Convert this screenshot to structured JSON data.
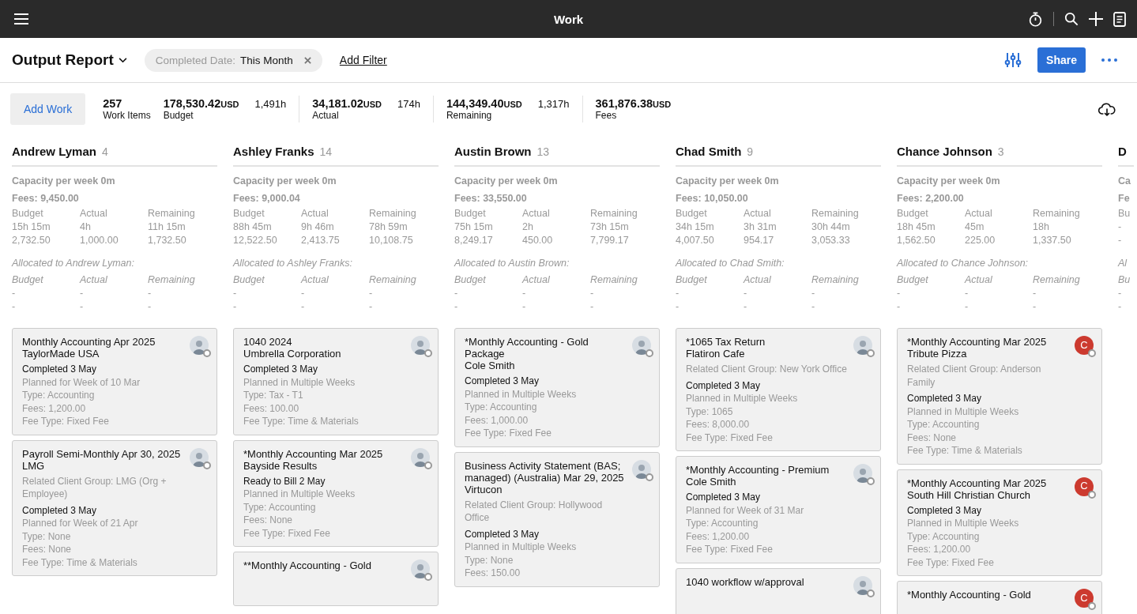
{
  "app_bar": {
    "title": "Work"
  },
  "toolbar": {
    "report_title": "Output Report",
    "filter": {
      "label": "Completed Date:",
      "value": "This Month"
    },
    "add_filter": "Add Filter",
    "share": "Share"
  },
  "summary": {
    "add_button": "Add Work",
    "stats": [
      {
        "value": "257",
        "label": "Work Items"
      },
      {
        "value": "178,530.42",
        "unit": "USD",
        "hours": "1,491h",
        "label": "Budget"
      },
      {
        "value": "34,181.02",
        "unit": "USD",
        "hours": "174h",
        "label": "Actual"
      },
      {
        "value": "144,349.40",
        "unit": "USD",
        "hours": "1,317h",
        "label": "Remaining"
      },
      {
        "value": "361,876.38",
        "unit": "USD",
        "label": "Fees"
      }
    ]
  },
  "columns": [
    {
      "name": "Andrew Lyman",
      "count": "4",
      "capacity": "Capacity per week 0m",
      "fees": "Fees: 9,450.00",
      "totals": {
        "headers": [
          "Budget",
          "Actual",
          "Remaining"
        ],
        "hours": [
          "15h 15m",
          "4h",
          "11h 15m"
        ],
        "amounts": [
          "2,732.50",
          "1,000.00",
          "1,732.50"
        ]
      },
      "allocated_label": "Allocated to Andrew Lyman:",
      "allocated": {
        "headers": [
          "Budget",
          "Actual",
          "Remaining"
        ],
        "hours": [
          "-",
          "-",
          "-"
        ],
        "amounts": [
          "-",
          "-",
          "-"
        ]
      },
      "cards": [
        {
          "title": "Monthly Accounting Apr 2025",
          "client": "TaylorMade USA",
          "status": "Completed 3 May",
          "details": [
            "Planned for Week of 10 Mar",
            "Type: Accounting",
            "Fees: 1,200.00",
            "Fee Type: Fixed Fee"
          ],
          "avatar": {
            "kind": "photo"
          }
        },
        {
          "title": "Payroll Semi-Monthly Apr 30, 2025",
          "client": "LMG",
          "related": "Related Client Group: LMG (Org + Employee)",
          "status": "Completed 3 May",
          "details": [
            "Planned for Week of 21 Apr",
            "Type: None",
            "Fees: None",
            "Fee Type: Time & Materials"
          ],
          "avatar": {
            "kind": "photo"
          }
        }
      ]
    },
    {
      "name": "Ashley Franks",
      "count": "14",
      "capacity": "Capacity per week 0m",
      "fees": "Fees: 9,000.04",
      "totals": {
        "headers": [
          "Budget",
          "Actual",
          "Remaining"
        ],
        "hours": [
          "88h 45m",
          "9h 46m",
          "78h 59m"
        ],
        "amounts": [
          "12,522.50",
          "2,413.75",
          "10,108.75"
        ]
      },
      "allocated_label": "Allocated to Ashley Franks:",
      "allocated": {
        "headers": [
          "Budget",
          "Actual",
          "Remaining"
        ],
        "hours": [
          "-",
          "-",
          "-"
        ],
        "amounts": [
          "-",
          "-",
          "-"
        ]
      },
      "cards": [
        {
          "title": "1040 2024",
          "client": "Umbrella Corporation",
          "status": "Completed 3 May",
          "details": [
            "Planned in Multiple Weeks",
            "Type: Tax - T1",
            "Fees: 100.00",
            "Fee Type: Time & Materials"
          ],
          "avatar": {
            "kind": "photo"
          }
        },
        {
          "title": "*Monthly Accounting Mar 2025",
          "client": "Bayside Results",
          "status": "Ready to Bill 2 May",
          "details": [
            "Planned in Multiple Weeks",
            "Type: Accounting",
            "Fees: None",
            "Fee Type: Fixed Fee"
          ],
          "avatar": {
            "kind": "photo"
          }
        },
        {
          "title": "**Monthly Accounting - Gold",
          "avatar": {
            "kind": "photo"
          }
        }
      ]
    },
    {
      "name": "Austin Brown",
      "count": "13",
      "capacity": "Capacity per week 0m",
      "fees": "Fees: 33,550.00",
      "totals": {
        "headers": [
          "Budget",
          "Actual",
          "Remaining"
        ],
        "hours": [
          "75h 15m",
          "2h",
          "73h 15m"
        ],
        "amounts": [
          "8,249.17",
          "450.00",
          "7,799.17"
        ]
      },
      "allocated_label": "Allocated to Austin Brown:",
      "allocated": {
        "headers": [
          "Budget",
          "Actual",
          "Remaining"
        ],
        "hours": [
          "-",
          "-",
          "-"
        ],
        "amounts": [
          "-",
          "-",
          "-"
        ]
      },
      "cards": [
        {
          "title": "*Monthly Accounting - Gold Package",
          "client": "Cole Smith",
          "status": "Completed 3 May",
          "details": [
            "Planned in Multiple Weeks",
            "Type: Accounting",
            "Fees: 1,000.00",
            "Fee Type: Fixed Fee"
          ],
          "avatar": {
            "kind": "photo"
          }
        },
        {
          "title": "Business Activity Statement (BAS; managed) (Australia) Mar 29, 2025",
          "client": "Virtucon",
          "related": "Related Client Group: Hollywood Office",
          "status": "Completed 3 May",
          "details": [
            "Planned in Multiple Weeks",
            "Type: None",
            "Fees: 150.00"
          ],
          "avatar": {
            "kind": "photo"
          }
        }
      ]
    },
    {
      "name": "Chad Smith",
      "count": "9",
      "capacity": "Capacity per week 0m",
      "fees": "Fees: 10,050.00",
      "totals": {
        "headers": [
          "Budget",
          "Actual",
          "Remaining"
        ],
        "hours": [
          "34h 15m",
          "3h 31m",
          "30h 44m"
        ],
        "amounts": [
          "4,007.50",
          "954.17",
          "3,053.33"
        ]
      },
      "allocated_label": "Allocated to Chad Smith:",
      "allocated": {
        "headers": [
          "Budget",
          "Actual",
          "Remaining"
        ],
        "hours": [
          "-",
          "-",
          "-"
        ],
        "amounts": [
          "-",
          "-",
          "-"
        ]
      },
      "cards": [
        {
          "title": "*1065 Tax Return",
          "client": "Flatiron Cafe",
          "related": "Related Client Group: New York Office",
          "status": "Completed 3 May",
          "details": [
            "Planned in Multiple Weeks",
            "Type: 1065",
            "Fees: 8,000.00",
            "Fee Type: Fixed Fee"
          ],
          "avatar": {
            "kind": "photo"
          }
        },
        {
          "title": "*Monthly Accounting - Premium",
          "client": "Cole Smith",
          "status": "Completed 3 May",
          "details": [
            "Planned for Week of 31 Mar",
            "Type: Accounting",
            "Fees: 1,200.00",
            "Fee Type: Fixed Fee"
          ],
          "avatar": {
            "kind": "photo"
          }
        },
        {
          "title": "1040 workflow w/approval",
          "avatar": {
            "kind": "photo"
          }
        }
      ]
    },
    {
      "name": "Chance Johnson",
      "count": "3",
      "capacity": "Capacity per week 0m",
      "fees": "Fees: 2,200.00",
      "totals": {
        "headers": [
          "Budget",
          "Actual",
          "Remaining"
        ],
        "hours": [
          "18h 45m",
          "45m",
          "18h"
        ],
        "amounts": [
          "1,562.50",
          "225.00",
          "1,337.50"
        ]
      },
      "allocated_label": "Allocated to Chance Johnson:",
      "allocated": {
        "headers": [
          "Budget",
          "Actual",
          "Remaining"
        ],
        "hours": [
          "-",
          "-",
          "-"
        ],
        "amounts": [
          "-",
          "-",
          "-"
        ]
      },
      "cards": [
        {
          "title": "*Monthly Accounting Mar 2025",
          "client": "Tribute Pizza",
          "related": "Related Client Group: Anderson Family",
          "status": "Completed 3 May",
          "details": [
            "Planned in Multiple Weeks",
            "Type: Accounting",
            "Fees: None",
            "Fee Type: Time & Materials"
          ],
          "avatar": {
            "kind": "initial",
            "initial": "C",
            "color": "#cc3a2f"
          }
        },
        {
          "title": "*Monthly Accounting Mar 2025",
          "client": "South Hill Christian Church",
          "status": "Completed 3 May",
          "details": [
            "Planned in Multiple Weeks",
            "Type: Accounting",
            "Fees: 1,200.00",
            "Fee Type: Fixed Fee"
          ],
          "avatar": {
            "kind": "initial",
            "initial": "C",
            "color": "#cc3a2f"
          }
        },
        {
          "title": "*Monthly Accounting - Gold",
          "avatar": {
            "kind": "initial",
            "initial": "C",
            "color": "#cc3a2f"
          }
        }
      ]
    },
    {
      "name": "D",
      "capacity": "Ca",
      "fees": "Fe",
      "totals": {
        "headers": [
          "Bu"
        ],
        "hours": [
          "-"
        ],
        "amounts": [
          "-"
        ]
      },
      "allocated_label": "Al",
      "allocated": {
        "headers": [
          "Bu"
        ],
        "hours": [
          "-"
        ],
        "amounts": [
          "-"
        ]
      }
    }
  ]
}
